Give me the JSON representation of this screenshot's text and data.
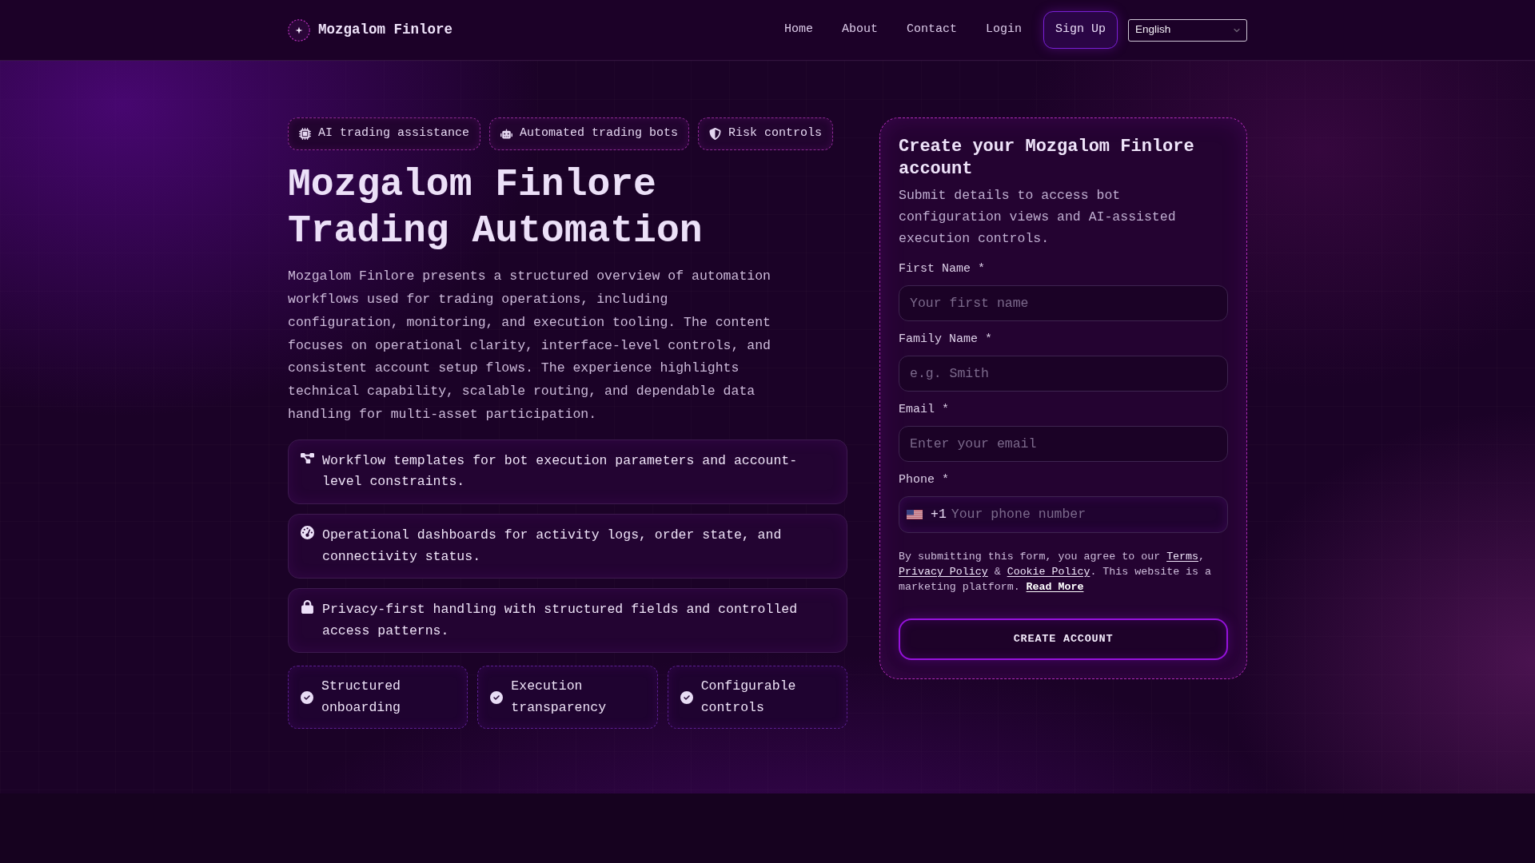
{
  "header": {
    "brand": "Mozgalom Finlore",
    "nav": [
      "Home",
      "About",
      "Contact",
      "Login"
    ],
    "signup_button": "Sign Up",
    "language_select": {
      "value": "English"
    }
  },
  "hero": {
    "badges": [
      "AI trading assistance",
      "Automated trading bots",
      "Risk controls"
    ],
    "title": "Mozgalom Finlore Trading Automation",
    "intro": "Mozgalom Finlore presents a structured overview of automation workflows used for trading operations, including configuration, monitoring, and execution tooling. The content focuses on operational clarity, interface-level controls, and consistent account setup flows. The experience highlights technical capability, scalable routing, and dependable data handling for multi-asset participation.",
    "features": [
      "Workflow templates for bot execution parameters and account-level constraints.",
      "Operational dashboards for activity logs, order state, and connectivity status.",
      "Privacy-first handling with structured fields and controlled access patterns."
    ],
    "highlights": [
      "Structured onboarding",
      "Execution transparency",
      "Configurable controls"
    ]
  },
  "signup_form": {
    "title": "Create your Mozgalom Finlore account",
    "subtitle": "Submit details to access bot configuration views and AI-assisted execution controls.",
    "fields": [
      {
        "kind": "text",
        "label": "First Name *",
        "placeholder": "Your first name"
      },
      {
        "kind": "text",
        "label": "Family Name *",
        "placeholder": "e.g. Smith"
      },
      {
        "kind": "email",
        "label": "Email *",
        "placeholder": "Enter your email"
      },
      {
        "kind": "phone",
        "label": "Phone *",
        "dial_code": "+1",
        "placeholder": "Your phone number"
      }
    ],
    "consent": [
      {
        "kind": "text",
        "text": "By submitting this form, you agree to our "
      },
      {
        "kind": "link",
        "text": "Terms"
      },
      {
        "kind": "text",
        "text": ", "
      },
      {
        "kind": "link",
        "text": "Privacy Policy"
      },
      {
        "kind": "text",
        "text": " & "
      },
      {
        "kind": "link",
        "text": "Cookie Policy"
      },
      {
        "kind": "text",
        "text": ". This website is a marketing platform. "
      },
      {
        "kind": "strong_link",
        "text": "Read More"
      }
    ],
    "submit_button": "CREATE ACCOUNT"
  }
}
